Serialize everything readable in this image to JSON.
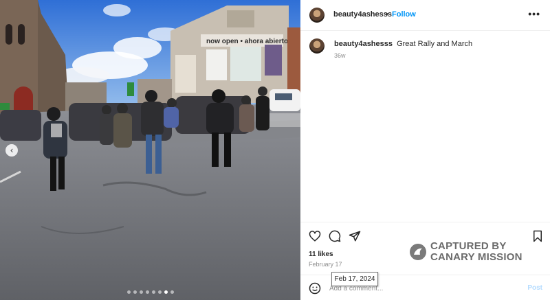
{
  "post": {
    "username": "beauty4ashesss",
    "separator": "•",
    "follow_label": "Follow",
    "more_label": "•••",
    "caption_user": "beauty4ashesss",
    "caption_text": "Great Rally and March",
    "caption_age": "36w",
    "likes": "11 likes",
    "date": "February 17",
    "date_tooltip": "Feb 17, 2024",
    "comment_placeholder": "Add a comment...",
    "post_label": "Post"
  },
  "photo": {
    "sign_text": "now open • ahora abierto",
    "nav_arrow": "‹",
    "slides": [
      {
        "active": false
      },
      {
        "active": false
      },
      {
        "active": false
      },
      {
        "active": false
      },
      {
        "active": false
      },
      {
        "active": false
      },
      {
        "active": true
      },
      {
        "active": false
      }
    ]
  },
  "watermark": {
    "text": "CAPTURED BY\nCANARY MISSION"
  },
  "icons": [
    "heart-icon",
    "comment-icon",
    "share-icon",
    "bookmark-icon",
    "emoji-icon",
    "more-icon",
    "chevron-left-icon"
  ],
  "colors": {
    "follow": "#0095f6",
    "post_disabled": "#b3dbff",
    "muted": "#8e8e8e"
  }
}
